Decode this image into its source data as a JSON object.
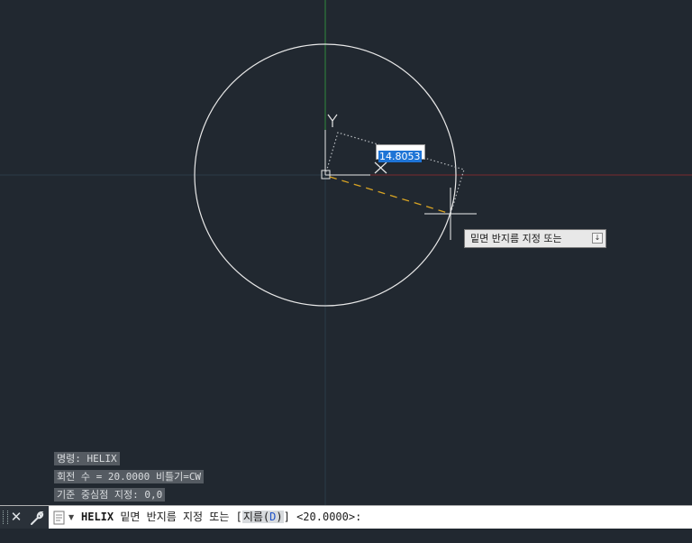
{
  "viewport": {
    "dimension_value": "14.8053",
    "ucs_y_label": "Y",
    "ucs_x_label": "X",
    "colors": {
      "background": "#212830",
      "y_axis": "#2f8a3c",
      "x_axis": "#8a2a2a",
      "circle": "#e8e8e8",
      "rubber_band": "#d9a423"
    },
    "tooltip": {
      "text": "밑면 반지름 지정 또는",
      "dropdown_icon": "down-arrow-icon"
    }
  },
  "history": [
    "명령: HELIX",
    "회전 수 = 20.0000 비틀기=CW",
    "기준 중심점 지정: 0,0"
  ],
  "command_line": {
    "command": "HELIX",
    "prompt_before": " 밑면 반지름 지정 또는 [",
    "option_key": "D",
    "option_before_key": "지름(",
    "option_after_key": ")",
    "prompt_after": "] <20.0000>:"
  }
}
